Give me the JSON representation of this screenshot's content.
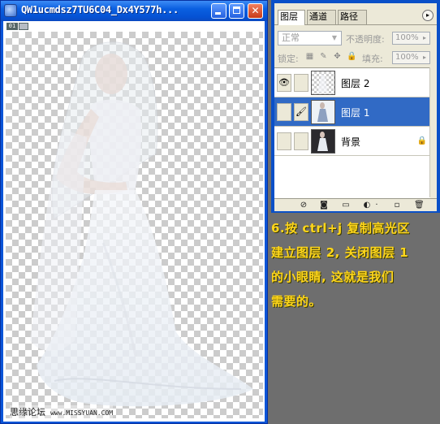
{
  "document_window": {
    "title": "QW1ucmdsz7TU6C04_Dx4Y577h...",
    "minimize_glyph": "_",
    "close_glyph": "✕",
    "badge": "01",
    "watermark": "思缘论坛",
    "watermark_url": "www.MISSYUAN.COM"
  },
  "layers_panel": {
    "tabs": [
      "图层",
      "通道",
      "路径"
    ],
    "menu_glyph": "▸",
    "blend_mode": "正常",
    "opacity_label": "不透明度:",
    "opacity_value": "100%",
    "lock_label": "锁定:",
    "fill_label": "填充:",
    "fill_value": "100%",
    "layers": [
      {
        "name": "图层 2",
        "visible": true,
        "selected": false,
        "thumbnail": "transparent"
      },
      {
        "name": "图层 1",
        "visible": false,
        "selected": true,
        "thumbnail": "photo"
      },
      {
        "name": "背景",
        "visible": false,
        "selected": false,
        "thumbnail": "photo-dark",
        "locked": true
      }
    ],
    "footer_icons": [
      "link-icon",
      "add-style-icon",
      "add-mask-icon",
      "new-set-icon",
      "adjustment-layer-icon",
      "new-layer-icon",
      "trash-icon"
    ]
  },
  "note": {
    "lines": [
      "6.按 ctrl+j 复制高光区",
      "建立图层 2, 关闭图层 1",
      "的小眼睛, 这就是我们",
      "需要的。"
    ]
  },
  "colors": {
    "xp_blue": "#0a55d8",
    "selection": "#316ac5",
    "note_text": "#ffd61a",
    "background": "#6e6e6e"
  }
}
